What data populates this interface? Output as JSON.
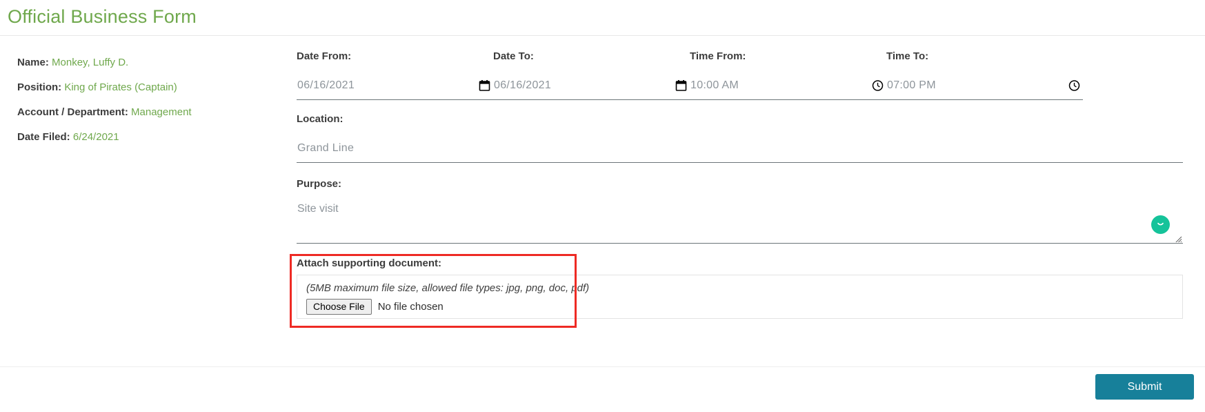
{
  "header": {
    "title": "Official Business Form"
  },
  "employee_info": [
    {
      "label": "Name:",
      "value": "Monkey, Luffy D."
    },
    {
      "label": "Position:",
      "value": "King of Pirates (Captain)"
    },
    {
      "label": "Account / Department:",
      "value": "Management"
    },
    {
      "label": "Date Filed:",
      "value": "6/24/2021"
    }
  ],
  "form": {
    "date_from": {
      "label": "Date From:",
      "value": "06/16/2021",
      "icon": "calendar-icon"
    },
    "date_to": {
      "label": "Date To:",
      "value": "06/16/2021",
      "icon": "calendar-icon"
    },
    "time_from": {
      "label": "Time From:",
      "value": "10:00 AM",
      "icon": "clock-icon"
    },
    "time_to": {
      "label": "Time To:",
      "value": "07:00 PM",
      "icon": "clock-icon"
    },
    "location": {
      "label": "Location:",
      "value": "Grand Line"
    },
    "purpose": {
      "label": "Purpose:",
      "value": "Site visit",
      "badge_icon": "grammar-smiley-icon",
      "resize_icon": "resize-grip-icon"
    },
    "attachment": {
      "label": "Attach supporting document:",
      "hint": "(5MB maximum file size, allowed file types: jpg, png, doc, pdf)",
      "choose_file_label": "Choose File",
      "no_file_text": "No file chosen"
    }
  },
  "footer": {
    "submit_label": "Submit"
  },
  "colors": {
    "title_green": "#6fa84c",
    "value_green": "#6fa84c",
    "submit_teal": "#17809a",
    "highlight_red": "#ee2a24",
    "badge_green": "#15c39a",
    "placeholder_grey": "#8d949a"
  }
}
